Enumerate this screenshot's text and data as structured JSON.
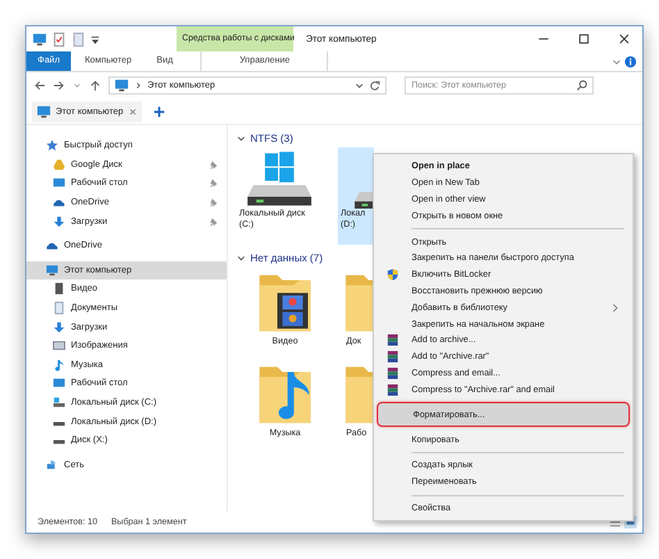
{
  "window": {
    "title": "Этот компьютер",
    "context_tab": "Средства работы с дисками"
  },
  "ribbon_tabs": [
    {
      "label": "Файл",
      "kind": "file",
      "selected": false
    },
    {
      "label": "Компьютер",
      "kind": "tab",
      "selected": false
    },
    {
      "label": "Вид",
      "kind": "tab",
      "selected": false
    },
    {
      "label": "Управление",
      "kind": "context",
      "selected": false
    }
  ],
  "address": {
    "path": "Этот компьютер",
    "search_placeholder": "Поиск: Этот компьютер"
  },
  "browser_tabs": [
    {
      "label": "Этот компьютер",
      "selected": true
    }
  ],
  "sidebar": [
    {
      "label": "Быстрый доступ",
      "kind": "star",
      "selected": false,
      "children": [
        {
          "label": "Google Диск",
          "kind": "gdrive",
          "pinned": true,
          "selected": false
        },
        {
          "label": "Рабочий стол",
          "kind": "desktop",
          "pinned": true,
          "selected": false
        },
        {
          "label": "OneDrive",
          "kind": "cloud",
          "pinned": true,
          "selected": false
        },
        {
          "label": "Загрузки",
          "kind": "download",
          "pinned": true,
          "selected": false
        }
      ]
    },
    {
      "label": "OneDrive",
      "kind": "cloud",
      "selected": false
    },
    {
      "label": "Этот компьютер",
      "kind": "pc",
      "selected": true,
      "children": [
        {
          "label": "Видео",
          "kind": "video",
          "pinned": false,
          "selected": false
        },
        {
          "label": "Документы",
          "kind": "docs",
          "pinned": false,
          "selected": false
        },
        {
          "label": "Загрузки",
          "kind": "download",
          "pinned": false,
          "selected": false
        },
        {
          "label": "Изображения",
          "kind": "pictures",
          "pinned": false,
          "selected": false
        },
        {
          "label": "Музыка",
          "kind": "music",
          "pinned": false,
          "selected": false
        },
        {
          "label": "Рабочий стол",
          "kind": "desktop",
          "pinned": false,
          "selected": false
        },
        {
          "label": "Локальный диск (C:)",
          "kind": "drive-win",
          "pinned": false,
          "selected": false
        },
        {
          "label": "Локальный диск (D:)",
          "kind": "drive",
          "pinned": false,
          "selected": false
        },
        {
          "label": "Диск (X:)",
          "kind": "drive",
          "pinned": false,
          "selected": false
        }
      ]
    },
    {
      "label": "Сеть",
      "kind": "network",
      "selected": false
    }
  ],
  "groups": [
    {
      "title": "NTFS (3)",
      "kind": "drives",
      "items": [
        {
          "lines": [
            "Локальный диск",
            "(C:)"
          ],
          "kind": "drive-win",
          "selected": false
        },
        {
          "lines": [
            "Локал",
            "(D:)"
          ],
          "kind": "drive",
          "selected": true
        }
      ]
    },
    {
      "title": "Нет данных (7)",
      "kind": "folders",
      "items": [
        {
          "lines": [
            "Видео"
          ],
          "kind": "video",
          "selected": false
        },
        {
          "lines": [
            "Док"
          ],
          "kind": "folder",
          "selected": false
        },
        {
          "lines": [
            "Музыка"
          ],
          "kind": "music",
          "selected": false
        },
        {
          "lines": [
            "Рабо"
          ],
          "kind": "folder",
          "selected": false
        }
      ]
    }
  ],
  "context_menu": [
    {
      "label": "Open in place",
      "kind": "bold",
      "selected": false
    },
    {
      "label": "Open in New Tab",
      "kind": "plain",
      "selected": false
    },
    {
      "label": "Open in other view",
      "kind": "plain",
      "selected": false
    },
    {
      "label": "Открыть в новом окне",
      "kind": "plain",
      "selected": false
    },
    {
      "kind": "separator"
    },
    {
      "label": "Открыть",
      "kind": "plain",
      "selected": false
    },
    {
      "label": "Закрепить на панели быстрого доступа",
      "kind": "plain",
      "selected": false
    },
    {
      "label": "Включить BitLocker",
      "kind": "shield",
      "selected": false
    },
    {
      "label": "Восстановить прежнюю версию",
      "kind": "plain",
      "selected": false
    },
    {
      "label": "Добавить в библиотеку",
      "kind": "submenu",
      "selected": false
    },
    {
      "label": "Закрепить на начальном экране",
      "kind": "plain",
      "selected": false
    },
    {
      "label": "Add to archive...",
      "kind": "archive",
      "selected": false
    },
    {
      "label": "Add to \"Archive.rar\"",
      "kind": "archive",
      "selected": false
    },
    {
      "label": "Compress and email...",
      "kind": "archive",
      "selected": false
    },
    {
      "label": "Compress to \"Archive.rar\" and email",
      "kind": "archive",
      "selected": false
    },
    {
      "label": "Форматировать...",
      "kind": "plain",
      "selected": true
    },
    {
      "label": "Копировать",
      "kind": "plain",
      "selected": false
    },
    {
      "kind": "separator"
    },
    {
      "label": "Создать ярлык",
      "kind": "plain",
      "selected": false
    },
    {
      "label": "Переименовать",
      "kind": "plain",
      "selected": false
    },
    {
      "kind": "separator"
    },
    {
      "label": "Свойства",
      "kind": "plain",
      "selected": false
    }
  ],
  "status_bar": {
    "count": "Элементов: 10",
    "selection": "Выбран 1 элемент"
  }
}
